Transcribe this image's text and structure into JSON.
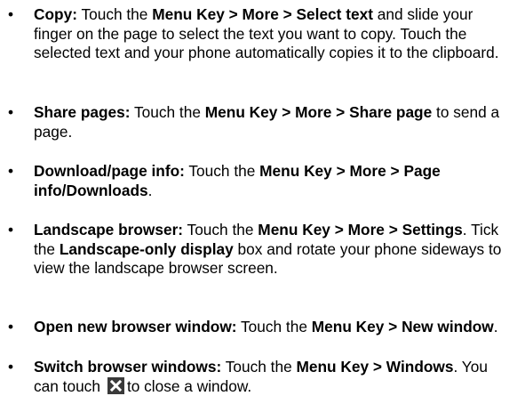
{
  "bullet_char": "•",
  "items": [
    {
      "lead": "Copy:",
      "t1": " Touch the ",
      "b1": "Menu Key > More > Select text",
      "t2": " and slide your finger on the page to select the text you want to copy. Touch the selected text and your phone automatically copies it to the clipboard."
    },
    {
      "lead": "Share pages:",
      "t1": " Touch the ",
      "b1": "Menu Key > More > Share page",
      "t2": " to send a page."
    },
    {
      "lead": "Download/page info:",
      "t1": " Touch the ",
      "b1": "Menu Key > More > Page info/Downloads",
      "t2": "."
    },
    {
      "lead": "Landscape browser:",
      "t1": " Touch the ",
      "b1": "Menu Key > More > Settings",
      "t2": ". Tick the ",
      "b2": "Landscape-only display",
      "t3": " box and rotate your phone sideways to view the landscape browser screen."
    },
    {
      "lead": "Open new browser window:",
      "t1": " Touch the ",
      "b1": "Menu Key > New window",
      "t2": "."
    },
    {
      "lead": "Switch browser windows:",
      "t1": " Touch the ",
      "b1": "Menu Key > Windows",
      "t2": ". You can touch",
      "icon": "close-icon",
      "t3": "to close a window."
    }
  ]
}
